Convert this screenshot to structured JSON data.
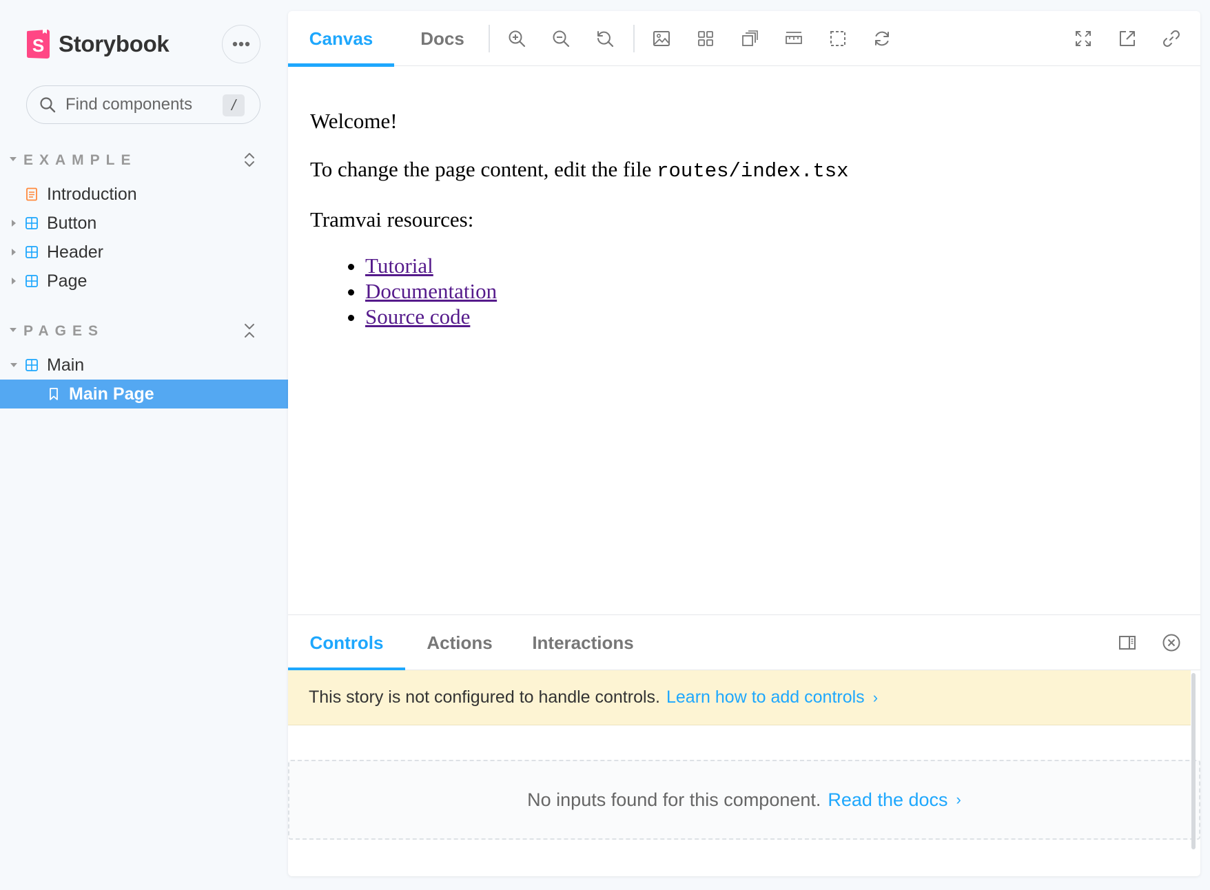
{
  "brand": {
    "name": "Storybook",
    "logo_letter": "S",
    "accent": "#ff4785"
  },
  "search": {
    "placeholder": "Find components",
    "shortcut": "/"
  },
  "sidebar": {
    "groups": [
      {
        "title": "EXAMPLE",
        "items": [
          {
            "label": "Introduction",
            "icon": "document-icon"
          },
          {
            "label": "Button",
            "icon": "component-icon"
          },
          {
            "label": "Header",
            "icon": "component-icon"
          },
          {
            "label": "Page",
            "icon": "component-icon"
          }
        ]
      },
      {
        "title": "PAGES",
        "items": [
          {
            "label": "Main",
            "icon": "component-icon"
          },
          {
            "label": "Main Page",
            "icon": "bookmark-icon",
            "selected": true
          }
        ]
      }
    ]
  },
  "toolbar": {
    "tabs": [
      "Canvas",
      "Docs"
    ],
    "active_tab": "Canvas",
    "tools": [
      "zoom-in-icon",
      "zoom-out-icon",
      "zoom-reset-icon",
      "background-icon",
      "grid-icon",
      "viewport-icon",
      "measure-icon",
      "outline-icon",
      "remount-icon"
    ],
    "right_tools": [
      "fullscreen-icon",
      "open-new-tab-icon",
      "copy-link-icon"
    ]
  },
  "canvas": {
    "welcome": "Welcome!",
    "change_text": "To change the page content, edit the file",
    "file_path": "routes/index.tsx",
    "resources_title": "Tramvai resources:",
    "links": [
      "Tutorial",
      "Documentation",
      "Source code"
    ]
  },
  "addons": {
    "tabs": [
      "Controls",
      "Actions",
      "Interactions"
    ],
    "active_tab": "Controls",
    "notice_text": "This story is not configured to handle controls.",
    "notice_link": "Learn how to add controls",
    "empty_text": "No inputs found for this component.",
    "empty_link": "Read the docs"
  },
  "colors": {
    "primary": "#1ea7fd",
    "selected_bg": "#54a8f2",
    "notice_bg": "#fdf4d3"
  }
}
